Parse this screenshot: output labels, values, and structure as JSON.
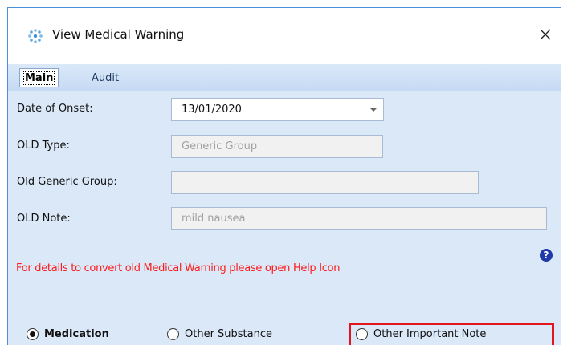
{
  "window": {
    "title": "View Medical Warning",
    "close_glyph": "✕"
  },
  "tabs": [
    {
      "label": "Main",
      "active": true
    },
    {
      "label": "Audit",
      "active": false
    }
  ],
  "form": {
    "date_of_onset": {
      "label": "Date of Onset:",
      "value": "13/01/2020"
    },
    "old_type": {
      "label": "OLD Type:",
      "value": "Generic Group"
    },
    "old_generic_group": {
      "label": "Old Generic Group:",
      "value": ""
    },
    "old_note": {
      "label": "OLD Note:",
      "value": "mild nausea"
    }
  },
  "warning": {
    "text": "For details to convert old Medical Warning please open Help Icon",
    "color": "#ff1a1a"
  },
  "help_icon": {
    "glyph": "?",
    "icon": "help-icon"
  },
  "radio_options": [
    {
      "label": "Medication",
      "selected": true
    },
    {
      "label": "Other Substance",
      "selected": false
    },
    {
      "label": "Other Important Note",
      "selected": false
    }
  ],
  "colors": {
    "accent_border": "#4a90d9",
    "panel_bg": "#dbe8f8",
    "highlight": "#e3141c",
    "help_icon": "#1f3aa8"
  }
}
